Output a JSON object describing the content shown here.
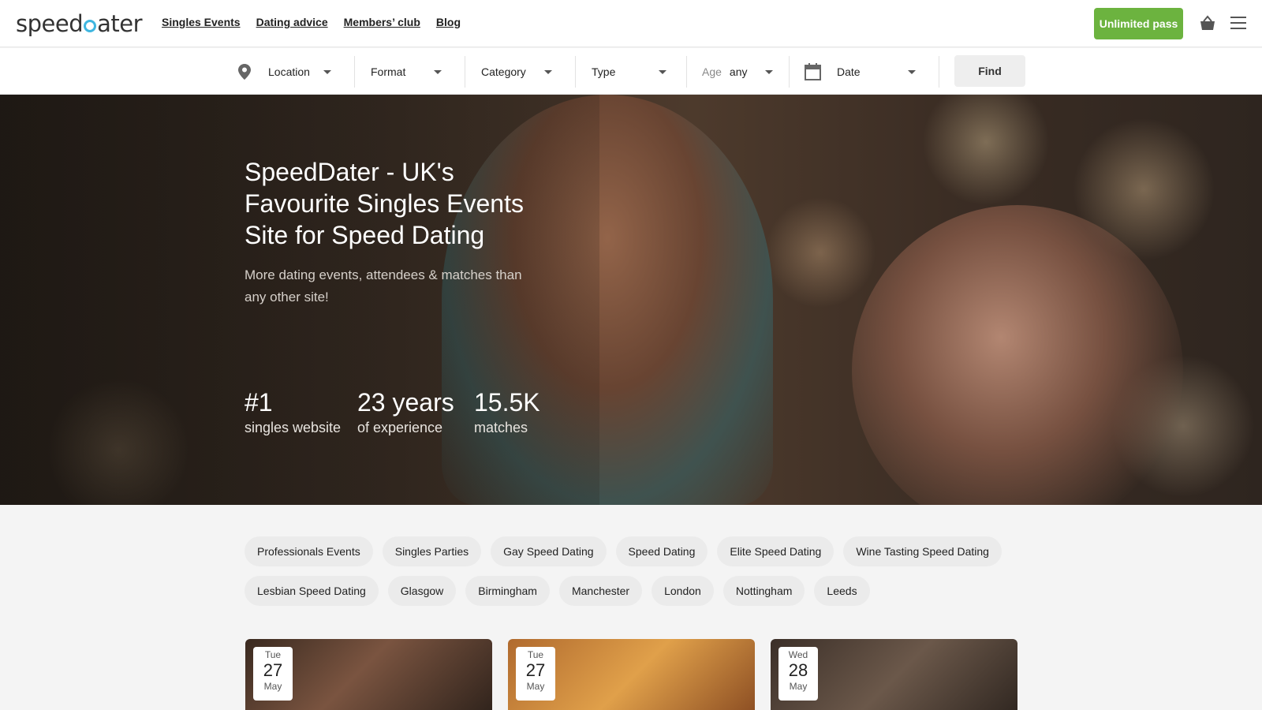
{
  "brand": {
    "logo_left": "speed",
    "logo_right": "ater"
  },
  "nav": {
    "items": [
      "Singles Events",
      "Dating advice",
      "Members’ club",
      "Blog"
    ]
  },
  "header": {
    "pass_label": "Unlimited pass"
  },
  "search": {
    "location": "Location",
    "format": "Format",
    "category": "Category",
    "type": "Type",
    "age_label": "Age",
    "age_value": "any",
    "date": "Date",
    "find_label": "Find"
  },
  "hero": {
    "title": "SpeedDater - UK's Favourite Singles Events Site for Speed Dating",
    "subtitle": "More dating events, attendees & matches than any other site!",
    "stats": [
      {
        "big": "#1",
        "small": "singles website"
      },
      {
        "big": "23 years",
        "small": "of experience"
      },
      {
        "big": "15.5K",
        "small": "matches"
      }
    ]
  },
  "chips": {
    "row1": [
      "Professionals Events",
      "Singles Parties",
      "Gay Speed Dating",
      "Speed Dating",
      "Elite Speed Dating",
      "Wine Tasting Speed Dating"
    ],
    "row2": [
      "Lesbian Speed Dating",
      "Glasgow",
      "Birmingham",
      "Manchester",
      "London",
      "Nottingham",
      "Leeds"
    ]
  },
  "events": [
    {
      "dow": "Tue",
      "day": "27",
      "month": "May"
    },
    {
      "dow": "Tue",
      "day": "27",
      "month": "May"
    },
    {
      "dow": "Wed",
      "day": "28",
      "month": "May"
    }
  ],
  "colors": {
    "accent": "#6cb33f",
    "logo_drop": "#3fb6e0"
  }
}
